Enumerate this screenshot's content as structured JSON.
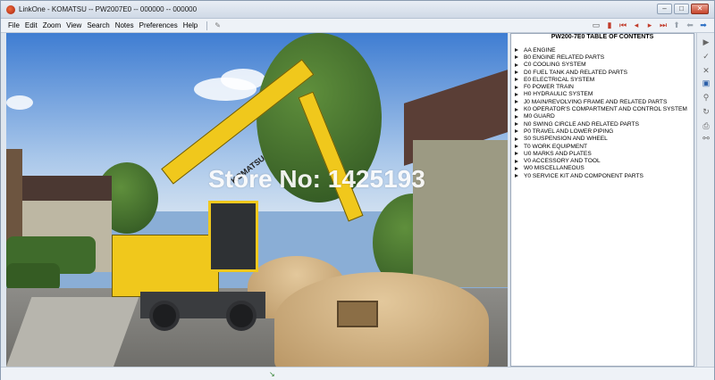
{
  "window": {
    "title": "LinkOne - KOMATSU -- PW2007E0 -- 000000 -- 000000"
  },
  "menu": {
    "items": [
      "File",
      "Edit",
      "Zoom",
      "View",
      "Search",
      "Notes",
      "Preferences",
      "Help"
    ]
  },
  "toolbar": {
    "icons": [
      "page-icon",
      "bookmark-icon",
      "first-icon",
      "prev-icon",
      "next-icon",
      "last-icon",
      "up-icon",
      "back-icon",
      "forward-icon"
    ]
  },
  "photo": {
    "brand_text": "KOMATSU",
    "watermark": "Store No: 1425193"
  },
  "toc": {
    "title": "PW200-7E0 TABLE OF CONTENTS",
    "items": [
      "AA ENGINE",
      "B0 ENGINE RELATED PARTS",
      "C0 COOLING SYSTEM",
      "D0 FUEL TANK AND RELATED PARTS",
      "E0 ELECTRICAL SYSTEM",
      "F0 POWER TRAIN",
      "H0 HYDRAULIC SYSTEM",
      "J0 MAIN/REVOLVING FRAME AND RELATED PARTS",
      "K0 OPERATOR'S COMPARTMENT AND CONTROL SYSTEM",
      "M0 GUARD",
      "N0 SWING CIRCLE AND RELATED PARTS",
      "P0 TRAVEL AND LOWER PIPING",
      "S0 SUSPENSION AND WHEEL",
      "T0 WORK EQUIPMENT",
      "U0 MARKS AND PLATES",
      "V0 ACCESSORY AND TOOL",
      "W0 MISCELLANEOUS",
      "Y0 SERVICE KIT AND COMPONENT PARTS"
    ]
  },
  "sidebar": {
    "icons": [
      "play-icon",
      "check-icon",
      "close-icon",
      "note-icon",
      "link-icon",
      "refresh-icon",
      "print-icon",
      "binoculars-icon",
      "zoom-icon"
    ]
  }
}
